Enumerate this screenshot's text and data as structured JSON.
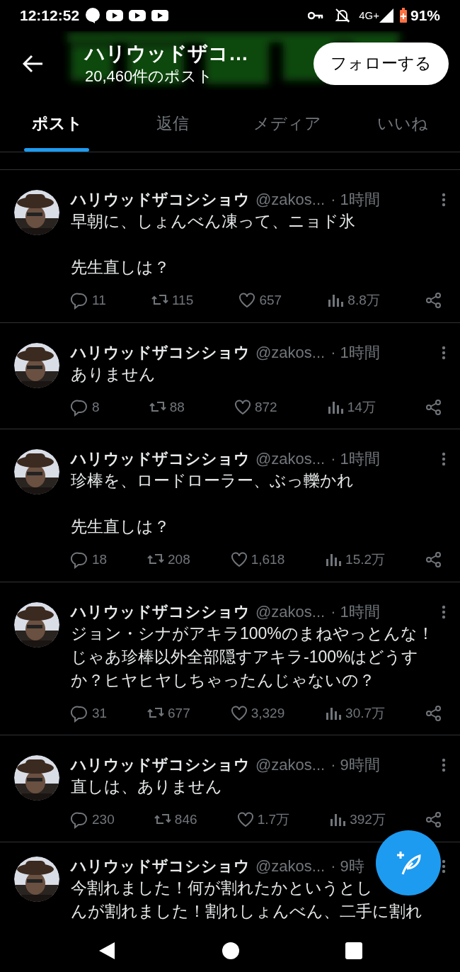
{
  "status_bar": {
    "time": "12:12:52",
    "network": "4G+",
    "battery": "91%"
  },
  "header": {
    "title": "ハリウッドザコ…",
    "post_count": "20,460件のポスト",
    "follow_button": "フォローする"
  },
  "tabs": [
    {
      "label": "ポスト",
      "selected": true
    },
    {
      "label": "返信",
      "selected": false
    },
    {
      "label": "メディア",
      "selected": false
    },
    {
      "label": "いいね",
      "selected": false
    }
  ],
  "posts": [
    {
      "name": "ハリウッドザコシショウ",
      "handle": "@zakos...",
      "time": "· 1時間",
      "paragraphs": [
        "早朝に、しょんべん凍って、ニョド氷",
        "先生直しは？"
      ],
      "replies": "11",
      "reposts": "115",
      "likes": "657",
      "views": "8.8万"
    },
    {
      "name": "ハリウッドザコシショウ",
      "handle": "@zakos...",
      "time": "· 1時間",
      "paragraphs": [
        "ありません"
      ],
      "replies": "8",
      "reposts": "88",
      "likes": "872",
      "views": "14万"
    },
    {
      "name": "ハリウッドザコシショウ",
      "handle": "@zakos...",
      "time": "· 1時間",
      "paragraphs": [
        "珍棒を、ロードローラー、ぶっ轢かれ",
        "先生直しは？"
      ],
      "replies": "18",
      "reposts": "208",
      "likes": "1,618",
      "views": "15.2万"
    },
    {
      "name": "ハリウッドザコシショウ",
      "handle": "@zakos...",
      "time": "· 1時間",
      "paragraphs": [
        "ジョン・シナがアキラ100%のまねやっとんな！じゃあ珍棒以外全部隠すアキラ-100%はどうすか？ヒヤヒヤしちゃったんじゃないの？"
      ],
      "replies": "31",
      "reposts": "677",
      "likes": "3,329",
      "views": "30.7万"
    },
    {
      "name": "ハリウッドザコシショウ",
      "handle": "@zakos...",
      "time": "· 9時間",
      "paragraphs": [
        "直しは、ありません"
      ],
      "replies": "230",
      "reposts": "846",
      "likes": "1.7万",
      "views": "392万"
    },
    {
      "name": "ハリウッドザコシショウ",
      "handle": "@zakos...",
      "time": "· 9時",
      "lines": [
        "今割れました！何が割れたかというとし",
        "んが割れました！割れしょんべん、二手に割れ"
      ]
    }
  ]
}
